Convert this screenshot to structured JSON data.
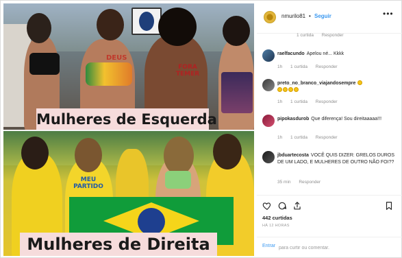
{
  "post": {
    "captions": {
      "top": "Mulheres de Esquerda",
      "bottom": "Mulheres de Direita"
    },
    "signs": {
      "chest_left": "DEUS",
      "back_right": "FORA TEMER",
      "shirt_left": "MEU PARTIDO"
    }
  },
  "header": {
    "username": "nmurilo81",
    "separator": "•",
    "follow_label": "Seguir",
    "more_label": "•••"
  },
  "first_meta": {
    "likes": "1 curtida",
    "reply": "Responder"
  },
  "comments": [
    {
      "user": "raelfacundo",
      "text": "Apelou né... Kkkk",
      "age": "1h",
      "likes": "1 curtida",
      "reply": "Responder"
    },
    {
      "user": "preto_no_branco_viajandosempre",
      "text": "",
      "age": "1h",
      "likes": "1 curtida",
      "reply": "Responder"
    },
    {
      "user": "pipokasdurob",
      "text": "Que diferença! Sou direitaaaaa!!!",
      "age": "1h",
      "likes": "1 curtida",
      "reply": "Responder"
    },
    {
      "user": "jbduartecosta",
      "text": "VOCÊ QUIS DIZER: GRELOS DUROS DE UM LADO, E MULHERES DE OUTRO NÃO FOI??",
      "age": "35 min",
      "likes": "",
      "reply": "Responder"
    }
  ],
  "actions": {
    "likes_count": "442 curtidas",
    "timestamp": "HÁ 12 HORAS"
  },
  "composer": {
    "link_label": "Entrar",
    "placeholder": "para curtir ou comentar."
  },
  "colors": {
    "accent": "#3897f0",
    "caption_bg": "#f6dcdc",
    "meta_gray": "#8e8e8e"
  }
}
